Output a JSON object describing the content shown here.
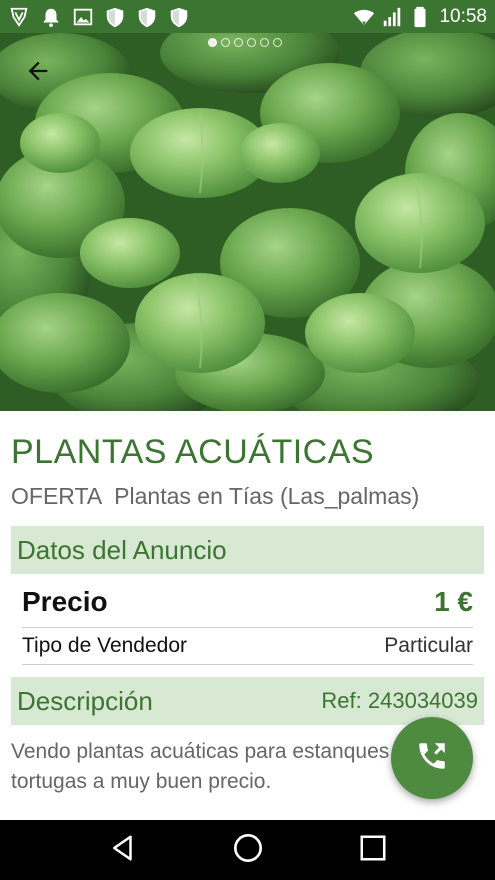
{
  "status_bar": {
    "time": "10:58",
    "left_icons": [
      "vpn-shield-icon",
      "notification-bell-icon",
      "image-icon",
      "shield-icon",
      "shield-icon",
      "shield-icon"
    ],
    "right_icons": [
      "wifi-icon",
      "signal-icon",
      "battery-icon"
    ]
  },
  "hero": {
    "image_subject": "water hyacinth aquatic plants",
    "carousel_dots": 6,
    "active_dot": 0
  },
  "listing": {
    "title": "PLANTAS ACUÁTICAS",
    "offer_type": "OFERTA",
    "location_text": "Plantas en Tías (Las_palmas)"
  },
  "ad_data": {
    "header": "Datos del Anuncio",
    "price_label": "Precio",
    "price_value": "1 €",
    "seller_label": "Tipo de Vendedor",
    "seller_value": "Particular"
  },
  "description": {
    "header": "Descripción",
    "ref": "Ref: 243034039",
    "text": "Vendo plantas acuáticas para estanques o tortugas a muy buen precio."
  },
  "colors": {
    "primary": "#3c7431",
    "section_bg": "#d7e8d3",
    "fab": "#4f8a41"
  }
}
